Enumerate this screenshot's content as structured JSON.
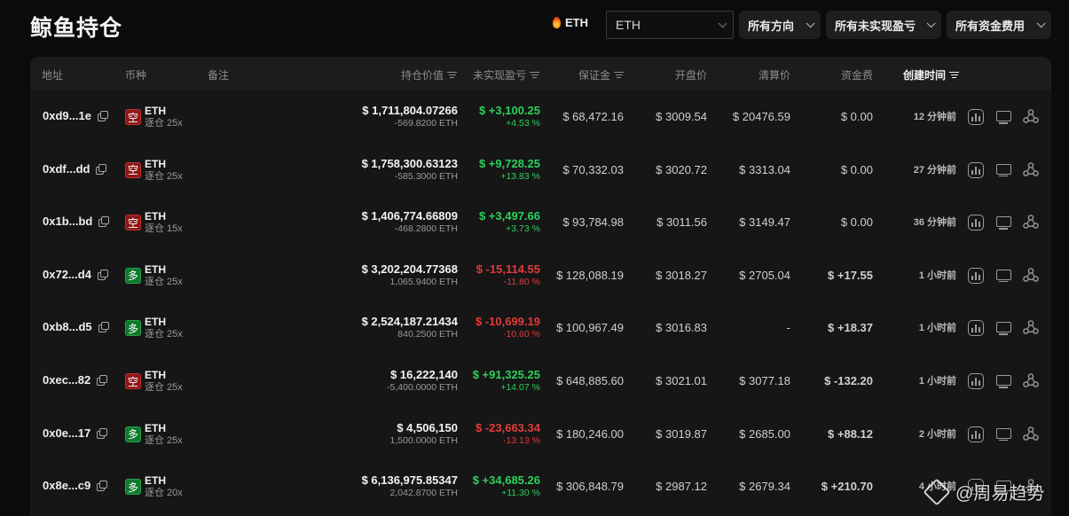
{
  "page": {
    "title": "鲸鱼持仓"
  },
  "toolbar": {
    "coin_tag": "ETH",
    "coin_select": "ETH",
    "filter_direction": "所有方向",
    "filter_pnl": "所有未实现盈亏",
    "filter_funding": "所有资金费用"
  },
  "table": {
    "headers": {
      "address": "地址",
      "coin": "币种",
      "note": "备注",
      "position_value": "持仓价值",
      "unrealized_pnl": "未实现盈亏",
      "margin": "保证金",
      "entry_price": "开盘价",
      "liq_price": "清算价",
      "funding": "资金费",
      "created": "创建时间"
    },
    "rows": [
      {
        "address": "0xd9...1e",
        "side": "空",
        "side_type": "short",
        "coin": "ETH",
        "leverage": "逐仓 25x",
        "note": "",
        "value": "$ 1,711,804.07266",
        "size": "-569.8200 ETH",
        "pnl": "$ +3,100.25",
        "pnl_pct": "+4.53 %",
        "pnl_sign": "pos",
        "margin": "$ 68,472.16",
        "entry": "$ 3009.54",
        "liq": "$ 20476.59",
        "funding": "$ 0.00",
        "funding_sign": "",
        "time": "12 分钟前"
      },
      {
        "address": "0xdf...dd",
        "side": "空",
        "side_type": "short",
        "coin": "ETH",
        "leverage": "逐仓 25x",
        "note": "",
        "value": "$ 1,758,300.63123",
        "size": "-585.3000 ETH",
        "pnl": "$ +9,728.25",
        "pnl_pct": "+13.83 %",
        "pnl_sign": "pos",
        "margin": "$ 70,332.03",
        "entry": "$ 3020.72",
        "liq": "$ 3313.04",
        "funding": "$ 0.00",
        "funding_sign": "",
        "time": "27 分钟前"
      },
      {
        "address": "0x1b...bd",
        "side": "空",
        "side_type": "short",
        "coin": "ETH",
        "leverage": "逐仓 15x",
        "note": "",
        "value": "$ 1,406,774.66809",
        "size": "-468.2800 ETH",
        "pnl": "$ +3,497.66",
        "pnl_pct": "+3.73 %",
        "pnl_sign": "pos",
        "margin": "$ 93,784.98",
        "entry": "$ 3011.56",
        "liq": "$ 3149.47",
        "funding": "$ 0.00",
        "funding_sign": "",
        "time": "36 分钟前"
      },
      {
        "address": "0x72...d4",
        "side": "多",
        "side_type": "long",
        "coin": "ETH",
        "leverage": "逐仓 25x",
        "note": "",
        "value": "$ 3,202,204.77368",
        "size": "1,065.9400 ETH",
        "pnl": "$ -15,114.55",
        "pnl_pct": "-11.80 %",
        "pnl_sign": "neg",
        "margin": "$ 128,088.19",
        "entry": "$ 3018.27",
        "liq": "$ 2705.04",
        "funding": "$ +17.55",
        "funding_sign": "pos",
        "time": "1 小时前"
      },
      {
        "address": "0xb8...d5",
        "side": "多",
        "side_type": "long",
        "coin": "ETH",
        "leverage": "逐仓 25x",
        "note": "",
        "value": "$ 2,524,187.21434",
        "size": "840.2500 ETH",
        "pnl": "$ -10,699.19",
        "pnl_pct": "-10.60 %",
        "pnl_sign": "neg",
        "margin": "$ 100,967.49",
        "entry": "$ 3016.83",
        "liq": "-",
        "funding": "$ +18.37",
        "funding_sign": "pos",
        "time": "1 小时前"
      },
      {
        "address": "0xec...82",
        "side": "空",
        "side_type": "short",
        "coin": "ETH",
        "leverage": "逐仓 25x",
        "note": "",
        "value": "$ 16,222,140",
        "size": "-5,400.0000 ETH",
        "pnl": "$ +91,325.25",
        "pnl_pct": "+14.07 %",
        "pnl_sign": "pos",
        "margin": "$ 648,885.60",
        "entry": "$ 3021.01",
        "liq": "$ 3077.18",
        "funding": "$ -132.20",
        "funding_sign": "neg",
        "time": "1 小时前"
      },
      {
        "address": "0x0e...17",
        "side": "多",
        "side_type": "long",
        "coin": "ETH",
        "leverage": "逐仓 25x",
        "note": "",
        "value": "$ 4,506,150",
        "size": "1,500.0000 ETH",
        "pnl": "$ -23,663.34",
        "pnl_pct": "-13.13 %",
        "pnl_sign": "neg",
        "margin": "$ 180,246.00",
        "entry": "$ 3019.87",
        "liq": "$ 2685.00",
        "funding": "$ +88.12",
        "funding_sign": "pos",
        "time": "2 小时前"
      },
      {
        "address": "0x8e...c9",
        "side": "多",
        "side_type": "long",
        "coin": "ETH",
        "leverage": "逐仓 20x",
        "note": "",
        "value": "$ 6,136,975.85347",
        "size": "2,042.8700 ETH",
        "pnl": "$ +34,685.26",
        "pnl_pct": "+11.30 %",
        "pnl_sign": "pos",
        "margin": "$ 306,848.79",
        "entry": "$ 2987.12",
        "liq": "$ 2679.34",
        "funding": "$ +210.70",
        "funding_sign": "pos",
        "time": "4 小时前"
      }
    ],
    "row_actions": [
      "chart-icon",
      "monitor-icon",
      "share-network-icon"
    ]
  },
  "watermark": "@周易趋势",
  "colors": {
    "positive": "#2bd15c",
    "negative": "#e23b3b",
    "short_badge": "#8e1717",
    "long_badge": "#0f7a2d",
    "background": "#0b0b0b",
    "panel": "#161616"
  }
}
